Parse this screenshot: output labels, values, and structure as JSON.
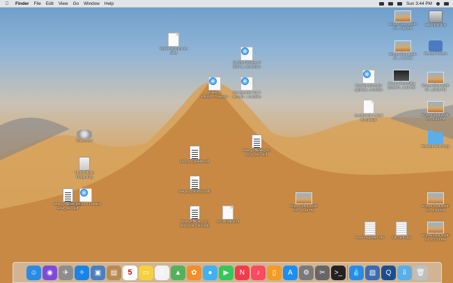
{
  "menubar": {
    "apple_icon": "apple-icon",
    "app": "Finder",
    "items": [
      "File",
      "Edit",
      "View",
      "Go",
      "Window",
      "Help"
    ],
    "clock": "Sun 3:44 PM"
  },
  "desktop": {
    "icons": [
      {
        "id": "mobile-docs",
        "label": "Mobile Documents alias",
        "kind": "doc"
      },
      {
        "id": "birth-cert",
        "label": "Certified Copies of Birth &...ds.webloc",
        "kind": "safari"
      },
      {
        "id": "public-webloc",
        "label": "public_s-effects....ff.webloc",
        "kind": "safari"
      },
      {
        "id": "change-os",
        "label": "Change your OS X account....rt.webloc",
        "kind": "safari"
      },
      {
        "id": "disable-auto",
        "label": "Disable automatic applicati...s.webloc",
        "kind": "safari"
      },
      {
        "id": "geekbench",
        "label": "Geekbench 4 2018 Mac.plugin",
        "kind": "doc"
      },
      {
        "id": "screen-recording",
        "label": "Screen Recording 2018-07...3.41 PM",
        "kind": "thumb-dark"
      },
      {
        "id": "sonos",
        "label": "Sonos.mov",
        "kind": "imove"
      },
      {
        "id": "tardis-dmg",
        "label": "Tardis Offsite Image.dmg",
        "kind": "dmg"
      },
      {
        "id": "imac-pdf",
        "label": "imac_27_late09.pdf",
        "kind": "pdf"
      },
      {
        "id": "macpro-pdf",
        "label": "macpro_mid2010.pdf",
        "kind": "pdf"
      },
      {
        "id": "mass-affiliate-1",
        "label": "Mass_Affiliate_Am azon_Ski...pdf",
        "kind": "pdf"
      },
      {
        "id": "mass-affiliate-2",
        "label": "Mass_Affiliate_Am azon_Ski...ufoo.pdf",
        "kind": "pdf"
      },
      {
        "id": "car-list",
        "label": "car list alpha.rtf",
        "kind": "doc"
      },
      {
        "id": "screenshot-l1",
        "label": "Screen Shot 2018-07...41.15 PM",
        "kind": "thumb"
      },
      {
        "id": "mass-left",
        "label": "Mass_Affiliate_Am azon_Ski...pdf",
        "kind": "pdf"
      },
      {
        "id": "webloc-left",
        "label": "Ido before ...t.webloc",
        "kind": "safari"
      },
      {
        "id": "mack-migrated",
        "label": "mack-migrated.xlsx",
        "kind": "xlsx"
      },
      {
        "id": "car-stuff",
        "label": "Car stuff.xlsx",
        "kind": "xlsx"
      }
    ],
    "right_column": [
      {
        "id": "ss-1",
        "label": "Screen Shot 2018-07...7.35 PM",
        "kind": "thumb"
      },
      {
        "id": "macintosh-hd",
        "label": "Macintosh HD",
        "kind": "hdd"
      },
      {
        "id": "ss-2",
        "label": "Screen Shot 2018-07...7.46 PM",
        "kind": "thumb"
      },
      {
        "id": "shared-folders",
        "label": "Shared Folders",
        "kind": "shared"
      },
      {
        "id": "ss-3",
        "label": "Screen Shot 2018-07...18.31 PM",
        "kind": "thumb"
      },
      {
        "id": "ss-4",
        "label": "Screen Shot 2018-07...5.43 PM",
        "kind": "thumb"
      },
      {
        "id": "desktop-stuff",
        "label": "Desktop Stuff copy",
        "kind": "folder"
      },
      {
        "id": "ss-5",
        "label": "Screen Shot 2018-07...2.49 PM",
        "kind": "thumb"
      },
      {
        "id": "ss-6",
        "label": "Screen Shot 2018-07...07.31 PM",
        "kind": "thumb"
      }
    ]
  },
  "dock": {
    "items": [
      {
        "name": "finder",
        "glyph": "☺",
        "bg": "#2a8be6"
      },
      {
        "name": "siri",
        "glyph": "◉",
        "bg": "#7d4bd8"
      },
      {
        "name": "launchpad",
        "glyph": "✈",
        "bg": "#8d8d8d"
      },
      {
        "name": "safari",
        "glyph": "✧",
        "bg": "#1a84e6"
      },
      {
        "name": "preview",
        "glyph": "▣",
        "bg": "#4a7fc1"
      },
      {
        "name": "contacts",
        "glyph": "▤",
        "bg": "#b88b52"
      },
      {
        "name": "calendar",
        "glyph": "5",
        "bg": "#ffffff"
      },
      {
        "name": "notes",
        "glyph": "▭",
        "bg": "#f4d23c"
      },
      {
        "name": "reminders",
        "glyph": "☰",
        "bg": "#f2f2f2"
      },
      {
        "name": "maps",
        "glyph": "▲",
        "bg": "#53b15c"
      },
      {
        "name": "photos",
        "glyph": "✿",
        "bg": "#f28e2b"
      },
      {
        "name": "messages",
        "glyph": "●",
        "bg": "#3fb2f0"
      },
      {
        "name": "facetime",
        "glyph": "▶",
        "bg": "#34c759"
      },
      {
        "name": "news",
        "glyph": "N",
        "bg": "#f23b4c"
      },
      {
        "name": "music",
        "glyph": "♪",
        "bg": "#fb4b5f"
      },
      {
        "name": "books",
        "glyph": "▯",
        "bg": "#f29b25"
      },
      {
        "name": "app-store",
        "glyph": "A",
        "bg": "#1c8ef0"
      },
      {
        "name": "system-preferences",
        "glyph": "⚙",
        "bg": "#7a7a7a"
      },
      {
        "name": "utilities",
        "glyph": "✂",
        "bg": "#666666"
      },
      {
        "name": "terminal",
        "glyph": ">_",
        "bg": "#222222"
      },
      {
        "name": "sep",
        "glyph": "",
        "bg": ""
      },
      {
        "name": "drops",
        "glyph": "💧",
        "bg": "#2a8be6"
      },
      {
        "name": "image-capture",
        "glyph": "▧",
        "bg": "#3b6cb0"
      },
      {
        "name": "quicktime",
        "glyph": "Q",
        "bg": "#1b4e8c"
      },
      {
        "name": "downloads",
        "glyph": "⇩",
        "bg": "#5aaeea"
      },
      {
        "name": "trash",
        "glyph": "🗑",
        "bg": "#bfbfbf"
      }
    ]
  }
}
